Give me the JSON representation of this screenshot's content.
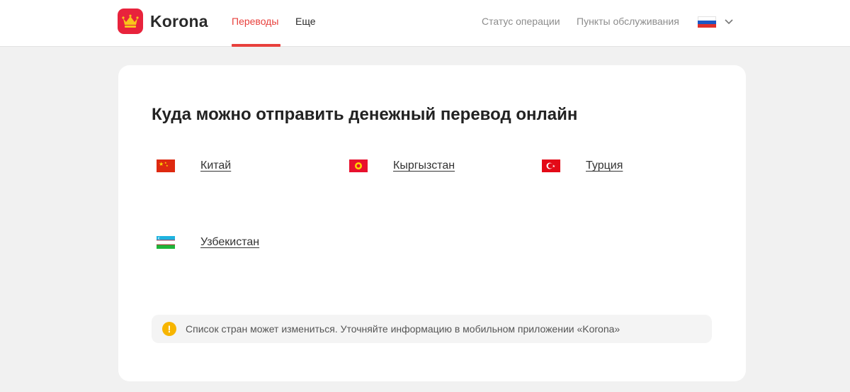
{
  "header": {
    "logo_text": "Korona",
    "nav": [
      {
        "label": "Переводы",
        "active": true
      },
      {
        "label": "Еще",
        "active": false
      }
    ],
    "links": [
      "Статус операции",
      "Пункты обслуживания"
    ],
    "language": {
      "flag": "ru-flag-icon",
      "dropdown_icon": "chevron-down-icon"
    }
  },
  "main": {
    "title": "Куда можно отправить денежный перевод онлайн",
    "countries": [
      {
        "name": "Китай",
        "flag": "china-flag-icon"
      },
      {
        "name": "Кыргызстан",
        "flag": "kyrgyzstan-flag-icon"
      },
      {
        "name": "Турция",
        "flag": "turkey-flag-icon"
      },
      {
        "name": "Узбекистан",
        "flag": "uzbekistan-flag-icon"
      }
    ],
    "notice": {
      "icon": "exclamation-icon",
      "text": "Список стран может измениться. Уточняйте информацию в мобильном приложении «Korona»"
    }
  },
  "colors": {
    "brand": "#e8233c",
    "accent": "#e8403c",
    "page_bg": "#f1f1f1",
    "warning": "#f7b500"
  }
}
